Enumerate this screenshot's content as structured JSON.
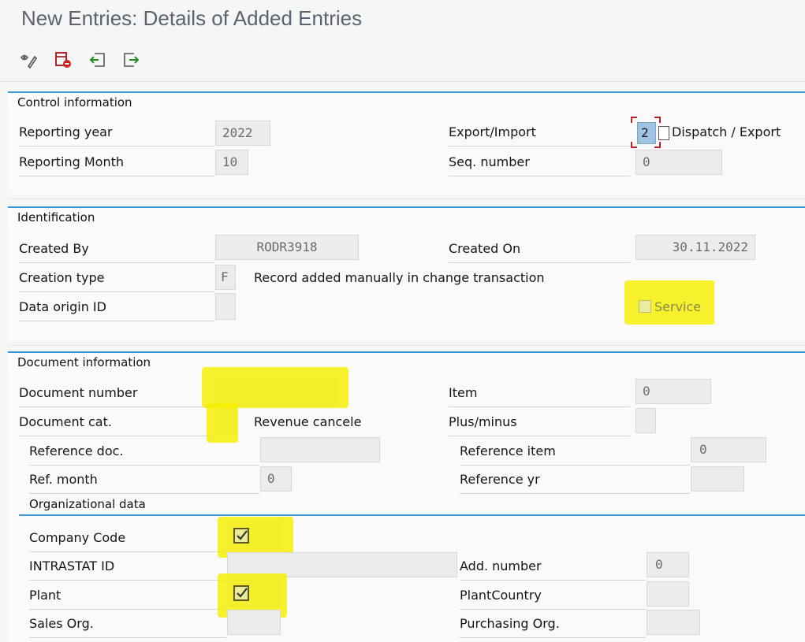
{
  "window": {
    "title": "New Entries: Details of Added Entries"
  },
  "toolbar": {
    "buttons": [
      "display-change-icon",
      "delete-icon",
      "back-icon",
      "next-icon"
    ]
  },
  "control": {
    "heading": "Control information",
    "reporting_year_label": "Reporting year",
    "reporting_year_value": "2022",
    "reporting_month_label": "Reporting Month",
    "reporting_month_value": "10",
    "export_import_label": "Export/Import",
    "export_import_value": "2",
    "export_import_text": "Dispatch / Export",
    "seq_number_label": "Seq. number",
    "seq_number_value": "0"
  },
  "identification": {
    "heading": "Identification",
    "created_by_label": "Created By",
    "created_by_value": "RODR3918",
    "created_on_label": "Created On",
    "created_on_value": "30.11.2022",
    "creation_type_label": "Creation type",
    "creation_type_value": "F",
    "creation_type_text": "Record added manually in change transaction",
    "data_origin_label": "Data origin ID",
    "data_origin_value": "",
    "service_label": "Service"
  },
  "document": {
    "heading": "Document information",
    "doc_number_label": "Document number",
    "doc_number_value": "",
    "item_label": "Item",
    "item_value": "0",
    "doc_cat_label": "Document cat.",
    "doc_cat_value": "",
    "doc_cat_text": "Revenue cancele",
    "plus_minus_label": "Plus/minus",
    "plus_minus_value": "",
    "ref_doc_label": "Reference doc.",
    "ref_doc_value": "",
    "ref_item_label": "Reference item",
    "ref_item_value": "0",
    "ref_month_label": "Ref. month",
    "ref_month_value": "0",
    "ref_yr_label": "Reference yr",
    "ref_yr_value": ""
  },
  "org": {
    "heading": "Organizational data",
    "company_code_label": "Company Code",
    "company_code_checked": true,
    "intrastat_label": "INTRASTAT ID",
    "intrastat_value": "",
    "add_number_label": "Add. number",
    "add_number_value": "0",
    "plant_label": "Plant",
    "plant_checked": true,
    "plant_country_label": "PlantCountry",
    "plant_country_value": "",
    "sales_org_label": "Sales Org.",
    "sales_org_value": "",
    "purchasing_org_label": "Purchasing Org.",
    "purchasing_org_value": ""
  },
  "colors": {
    "highlight": "#f5ee00",
    "section_rule": "#3f97d6",
    "focus": "#bb2222"
  }
}
